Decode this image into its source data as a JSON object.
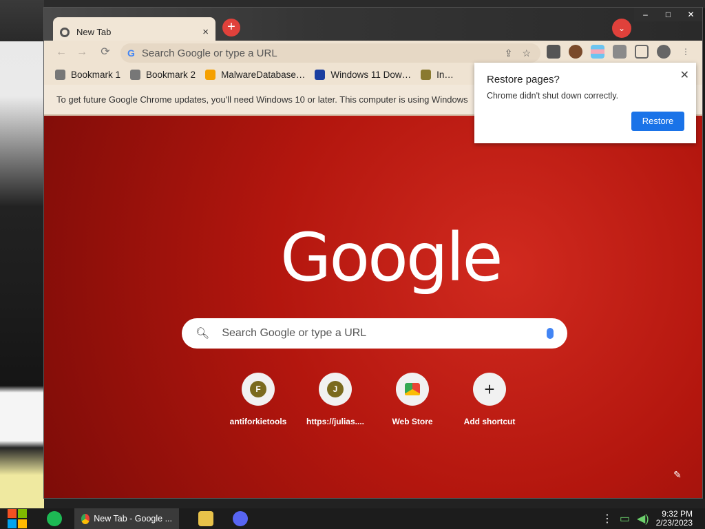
{
  "window": {
    "controls": [
      "–",
      "□",
      "✕"
    ]
  },
  "tab": {
    "title": "New Tab",
    "close": "×",
    "new": "+",
    "search": "⌄"
  },
  "toolbar": {
    "back": "←",
    "forward": "→",
    "reload": "⟳",
    "omnibox_placeholder": "Search Google or type a URL",
    "share": "⇪",
    "star": "☆"
  },
  "bookmarks": [
    {
      "label": "Bookmark 1",
      "icon": "bookmark-icon"
    },
    {
      "label": "Bookmark 2",
      "icon": "bookmark-icon"
    },
    {
      "label": "MalwareDatabase…",
      "icon": "ph-icon"
    },
    {
      "label": "Windows 11 Dow…",
      "icon": "x-icon"
    },
    {
      "label": "In…",
      "icon": "user-icon"
    }
  ],
  "infobar": {
    "text": "To get future Google Chrome updates, you'll need Windows 10 or later. This computer is using Windows"
  },
  "ntp": {
    "logo": "Google",
    "search_placeholder": "Search Google or type a URL",
    "shortcuts": [
      {
        "label": "antiforkietools",
        "letter": "F"
      },
      {
        "label": "https://julias....",
        "letter": "J"
      },
      {
        "label": "Web Store",
        "letter": ""
      },
      {
        "label": "Add shortcut",
        "letter": "+"
      }
    ],
    "edit": "✎"
  },
  "restore": {
    "title": "Restore pages?",
    "text": "Chrome didn't shut down correctly.",
    "button": "Restore",
    "close": "✕"
  },
  "taskbar": {
    "task_label": "New Tab - Google ...",
    "time": "9:32 PM",
    "date": "2/23/2023"
  }
}
